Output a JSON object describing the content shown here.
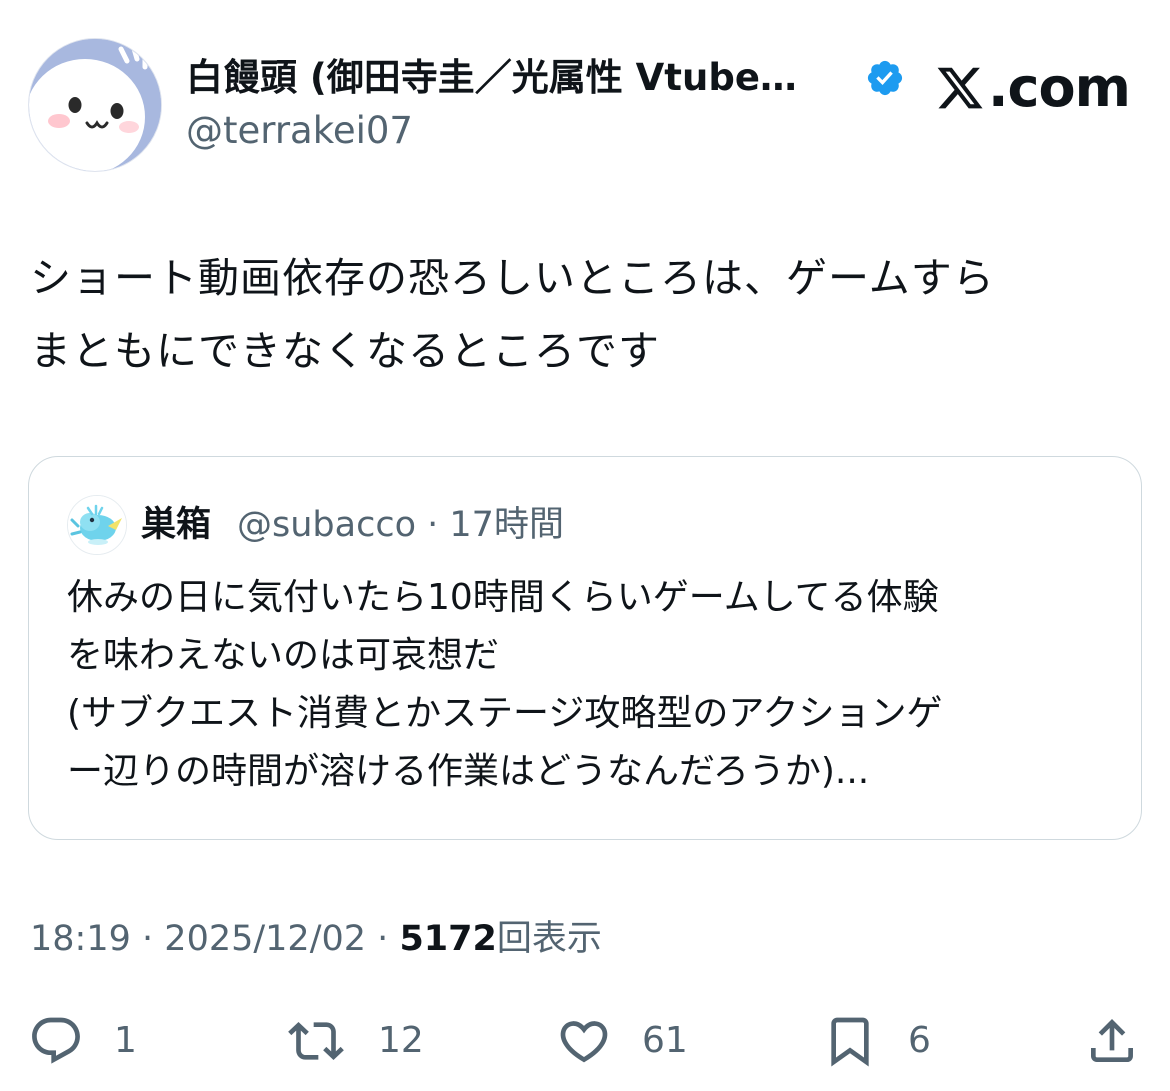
{
  "author": {
    "display_name": "白饅頭 (御田寺圭／光属性 Vtube…",
    "handle": "@terrakei07",
    "verified_icon": "verified-badge-icon",
    "verified_color": "#1d9bf0"
  },
  "brand": {
    "logo_text": ".com",
    "logo_icon": "x-logo-icon"
  },
  "tweet": {
    "lines": [
      "ショート動画依存の恐ろしいところは、ゲームすら",
      "まともにできなくなるところです"
    ]
  },
  "quote": {
    "name": "巣箱",
    "handle": "@subacco",
    "separator": "·",
    "time": "17時間",
    "lines": [
      "休みの日に気付いたら10時間くらいゲームしてる体験",
      "を味わえないのは可哀想だ",
      "(サブクエスト消費とかステージ攻略型のアクションゲ",
      "ー辺りの時間が溶ける作業はどうなんだろうか)..."
    ]
  },
  "meta": {
    "time": "18:19",
    "sep1": "·",
    "date": "2025/12/02",
    "sep2": "·",
    "views": "5172",
    "views_label": "回表示"
  },
  "actions": {
    "reply": {
      "count": "1",
      "icon": "reply-icon"
    },
    "repost": {
      "count": "12",
      "icon": "repost-icon"
    },
    "like": {
      "count": "61",
      "icon": "heart-icon"
    },
    "bookmark": {
      "count": "6",
      "icon": "bookmark-icon"
    },
    "share": {
      "icon": "share-icon"
    }
  },
  "colors": {
    "text": "#0f1419",
    "secondary": "#536471",
    "border": "#cfd9de",
    "accent": "#1d9bf0"
  }
}
